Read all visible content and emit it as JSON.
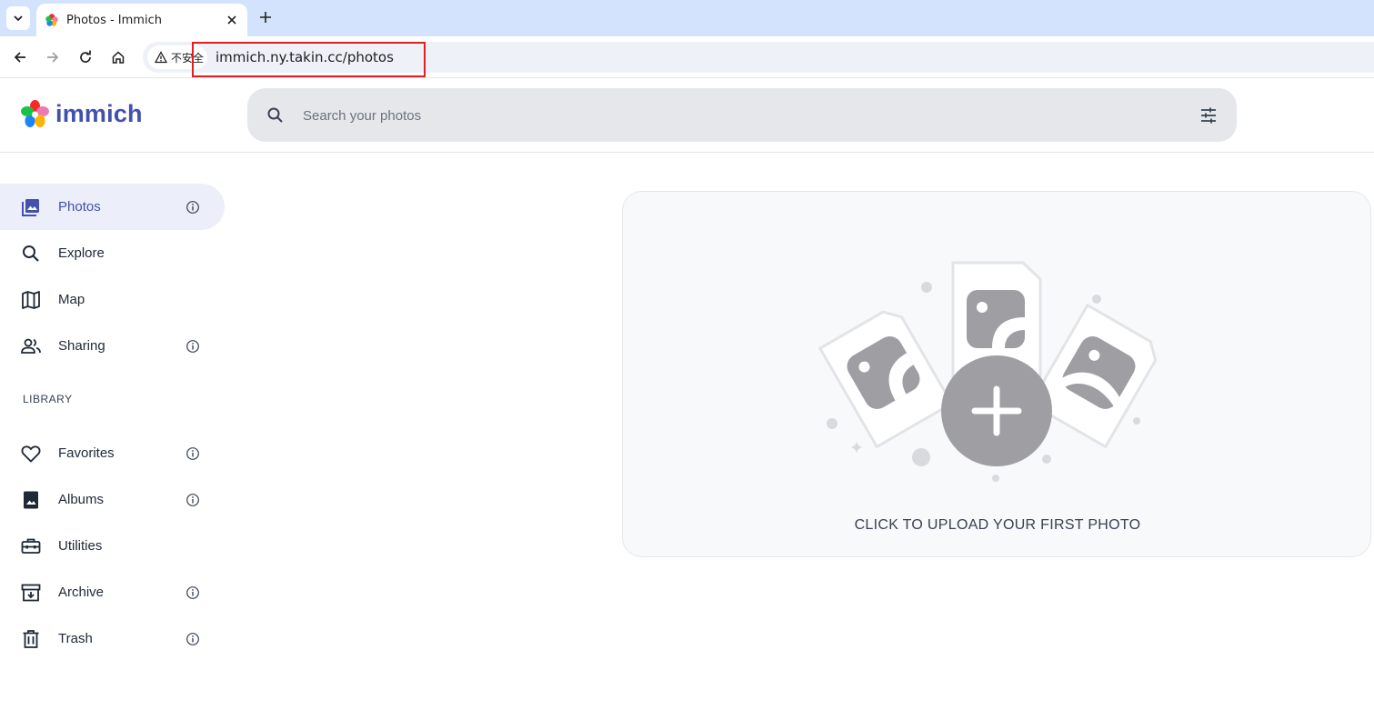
{
  "browser": {
    "tab_title": "Photos - Immich",
    "url": "immich.ny.takin.cc/photos",
    "security_label": "不安全"
  },
  "app": {
    "logo_text": "immich",
    "search_placeholder": "Search your photos"
  },
  "sidebar": {
    "items": [
      {
        "label": "Photos",
        "icon": "photos-icon",
        "active": true,
        "info": true
      },
      {
        "label": "Explore",
        "icon": "search-icon",
        "active": false,
        "info": false
      },
      {
        "label": "Map",
        "icon": "map-icon",
        "active": false,
        "info": false
      },
      {
        "label": "Sharing",
        "icon": "people-icon",
        "active": false,
        "info": true
      }
    ],
    "library_title": "LIBRARY",
    "library_items": [
      {
        "label": "Favorites",
        "icon": "heart-icon",
        "info": true
      },
      {
        "label": "Albums",
        "icon": "album-icon",
        "info": true
      },
      {
        "label": "Utilities",
        "icon": "toolbox-icon",
        "info": false
      },
      {
        "label": "Archive",
        "icon": "archive-icon",
        "info": true
      },
      {
        "label": "Trash",
        "icon": "trash-icon",
        "info": true
      }
    ]
  },
  "main": {
    "upload_label": "CLICK TO UPLOAD YOUR FIRST PHOTO"
  },
  "colors": {
    "brand": "#4250af",
    "active_bg": "#eceef9",
    "highlight_border": "#e02020"
  }
}
